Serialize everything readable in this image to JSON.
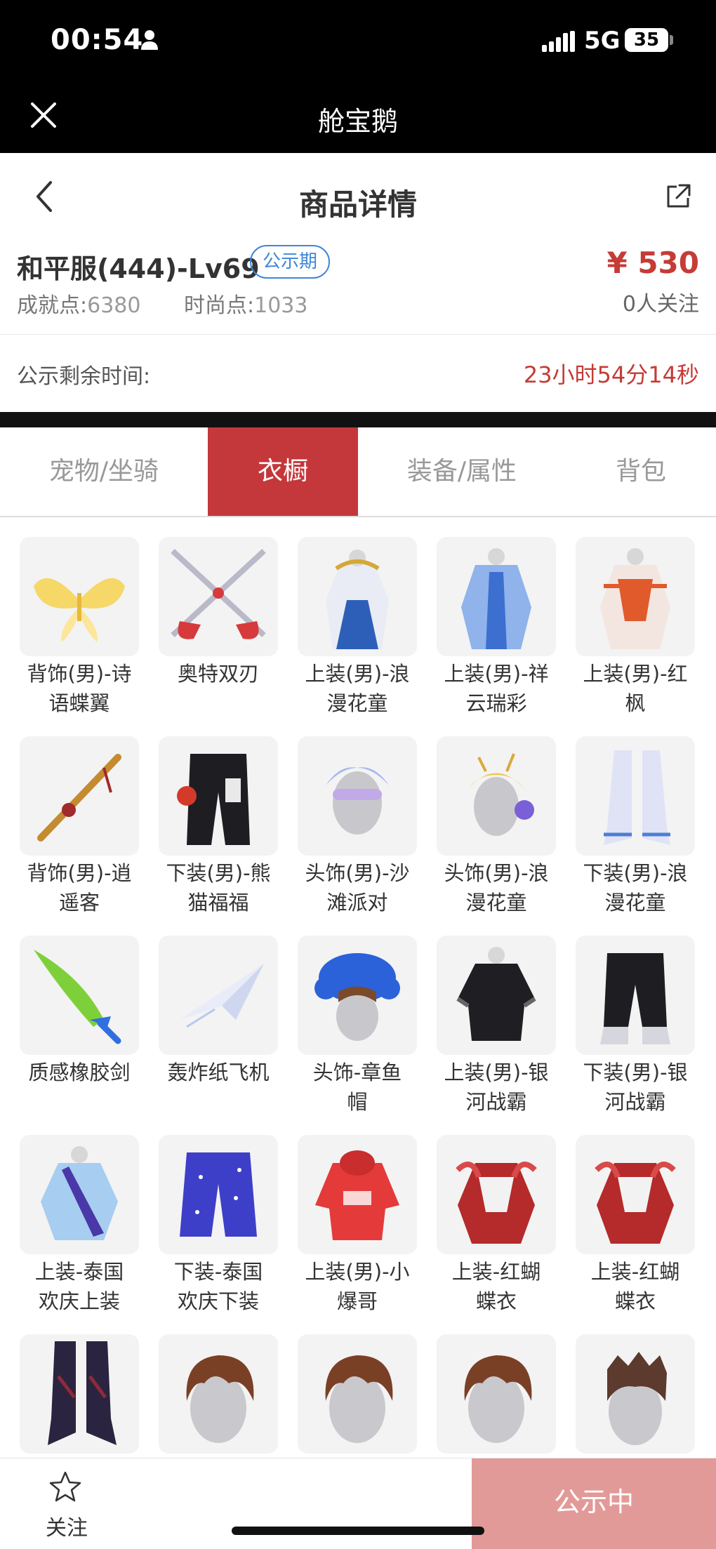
{
  "status_bar": {
    "time": "00:54",
    "network": "5G",
    "battery": "35"
  },
  "app_bar": {
    "title": "舱宝鹅"
  },
  "header": {
    "title": "商品详情"
  },
  "product": {
    "name": "和平服(444)-Lv69",
    "badge": "公示期",
    "price": "¥ 530",
    "achievement_label": "成就点:",
    "achievement_value": "6380",
    "fashion_label": "时尚点:",
    "fashion_value": "1033",
    "followers": "0人关注"
  },
  "timer": {
    "label": "公示剩余时间:",
    "value": "23小时54分14秒"
  },
  "tabs": [
    {
      "label": "宠物/坐骑",
      "active": false
    },
    {
      "label": "衣橱",
      "active": true
    },
    {
      "label": "装备/属性",
      "active": false
    },
    {
      "label": "背包",
      "active": false
    }
  ],
  "wardrobe_items": [
    {
      "line1": "背饰(男)-诗",
      "line2": "语蝶翼",
      "icon": "wings-icon"
    },
    {
      "line1": "奥特双刃",
      "line2": "",
      "icon": "crossed-blades-icon"
    },
    {
      "line1": "上装(男)-浪",
      "line2": "漫花童",
      "icon": "robe-gold-icon"
    },
    {
      "line1": "上装(男)-祥",
      "line2": "云瑞彩",
      "icon": "robe-blue-icon"
    },
    {
      "line1": "上装(男)-红",
      "line2": "枫",
      "icon": "robe-red-icon"
    },
    {
      "line1": "背饰(男)-逍",
      "line2": "遥客",
      "icon": "back-weapon-icon"
    },
    {
      "line1": "下装(男)-熊",
      "line2": "猫福福",
      "icon": "black-pants-icon"
    },
    {
      "line1": "头饰(男)-沙",
      "line2": "滩派对",
      "icon": "head-glasses-icon"
    },
    {
      "line1": "头饰(男)-浪",
      "line2": "漫花童",
      "icon": "head-flower-icon"
    },
    {
      "line1": "下装(男)-浪",
      "line2": "漫花童",
      "icon": "white-boots-icon"
    },
    {
      "line1": "质感橡胶剑",
      "line2": "",
      "icon": "green-sword-icon"
    },
    {
      "line1": "轰炸纸飞机",
      "line2": "",
      "icon": "paper-plane-icon"
    },
    {
      "line1": "头饰-章鱼",
      "line2": "帽",
      "icon": "octopus-hat-icon"
    },
    {
      "line1": "上装(男)-银",
      "line2": "河战霸",
      "icon": "black-hoodie-icon"
    },
    {
      "line1": "下装(男)-银",
      "line2": "河战霸",
      "icon": "black-pants2-icon"
    },
    {
      "line1": "上装-泰国",
      "line2": "欢庆上装",
      "icon": "thai-top-icon"
    },
    {
      "line1": "下装-泰国",
      "line2": "欢庆下装",
      "icon": "thai-pants-icon"
    },
    {
      "line1": "上装(男)-小",
      "line2": "爆哥",
      "icon": "red-hoodie-icon"
    },
    {
      "line1": "上装-红蝴",
      "line2": "蝶衣",
      "icon": "red-butterfly-icon"
    },
    {
      "line1": "上装-红蝴",
      "line2": "蝶衣",
      "icon": "red-butterfly-icon"
    },
    {
      "line1": "",
      "line2": "",
      "icon": "dark-boots-icon"
    },
    {
      "line1": "",
      "line2": "",
      "icon": "brown-hair-icon"
    },
    {
      "line1": "",
      "line2": "",
      "icon": "brown-hair-icon"
    },
    {
      "line1": "",
      "line2": "",
      "icon": "brown-hair-icon"
    },
    {
      "line1": "",
      "line2": "",
      "icon": "spiky-hair-icon"
    }
  ],
  "bottom_bar": {
    "follow_label": "关注",
    "status_label": "公示中"
  },
  "colors": {
    "accent_red": "#c4373b",
    "price_red": "#c53b36",
    "badge_blue": "#3f86d6",
    "status_button": "#e29a98"
  }
}
